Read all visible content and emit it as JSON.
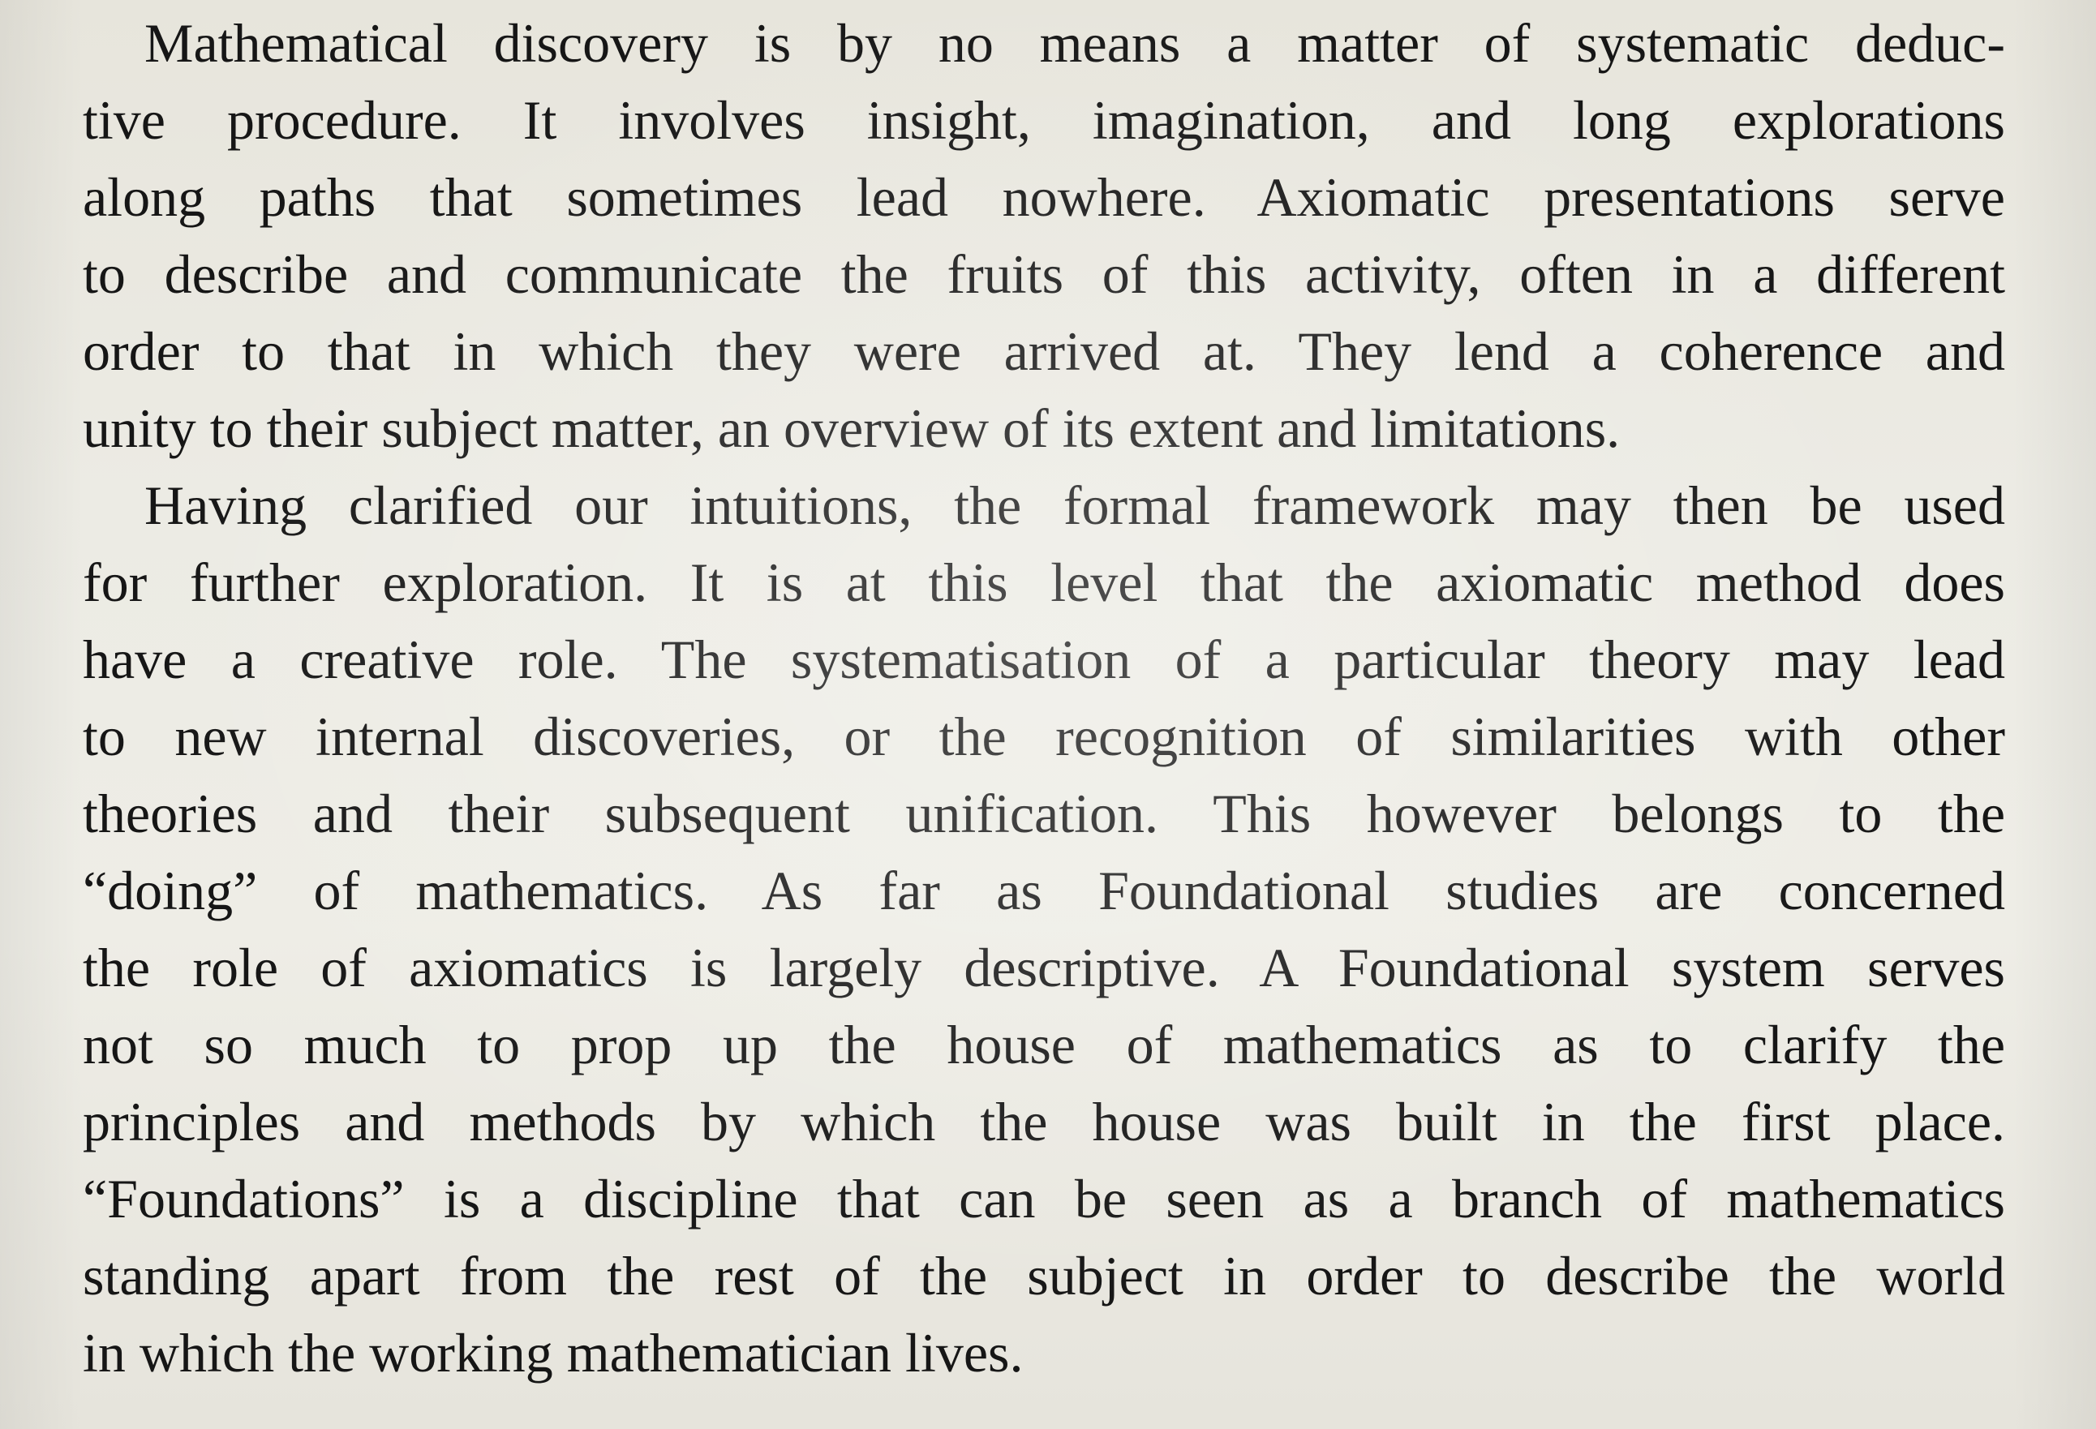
{
  "document": {
    "paragraphs": [
      {
        "lines": [
          "Mathematical discovery is by no means a matter of systematic deduc-",
          "tive procedure. It involves insight, imagination, and long explorations",
          "along paths that sometimes lead nowhere. Axiomatic presentations serve",
          "to describe and communicate the fruits of this activity, often in a different",
          "order to that in which they were arrived at. They lend a coherence and",
          "unity to their subject matter, an overview of its extent and limitations."
        ]
      },
      {
        "lines": [
          "Having clarified our intuitions, the formal framework may then be used",
          "for further exploration. It is at this level that the axiomatic method does",
          "have a creative role. The systematisation of a particular theory may lead",
          "to new internal discoveries, or the recognition of similarities with other",
          "theories and their subsequent unification. This however belongs to the",
          "“doing” of mathematics. As far as Foundational studies are concerned",
          "the role of axiomatics is largely descriptive. A Foundational system serves",
          "not so much to prop up the house of mathematics as to clarify the",
          "principles and methods by which the house was built in the first place.",
          "“Foundations” is a discipline that can be seen as a branch of mathematics",
          "standing apart from the rest of the subject in order to describe the world",
          "in which the working mathematician lives."
        ]
      }
    ]
  }
}
